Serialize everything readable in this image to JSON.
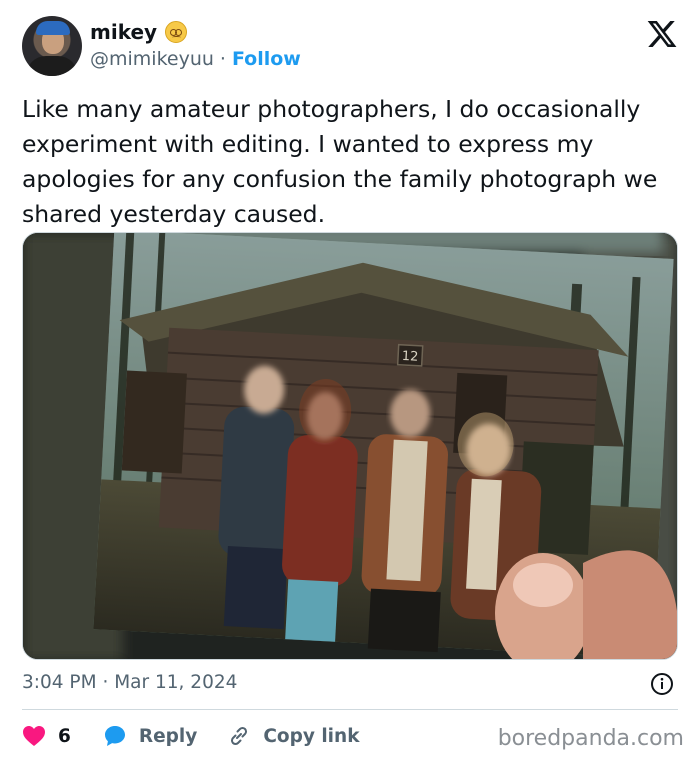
{
  "user": {
    "display_name": "mikey",
    "handle": "@mimikeyuu",
    "separator": "·",
    "follow_label": "Follow"
  },
  "tweet": {
    "text": "Like many amateur photographers, I do occasionally experiment with editing. I wanted to express my apologies for any confusion the family photograph we shared yesterday caused.",
    "photo": {
      "cabin_number": "12"
    },
    "time": "3:04 PM",
    "date": "Mar 11, 2024",
    "meta_separator": "·"
  },
  "actions": {
    "like_count": "6",
    "reply_label": "Reply",
    "copy_link_label": "Copy link"
  },
  "watermark": "boredpanda.com",
  "colors": {
    "accent": "#1d9bf0",
    "like": "#f91880",
    "reply_icon": "#1d9bf0",
    "text": "#0f1419",
    "muted": "#536471"
  },
  "icons": {
    "logo": "x-logo-icon",
    "emoji": "woozy-face-emoji-icon",
    "info": "info-icon",
    "like": "heart-icon",
    "reply": "speech-bubble-icon",
    "copy": "link-icon"
  }
}
